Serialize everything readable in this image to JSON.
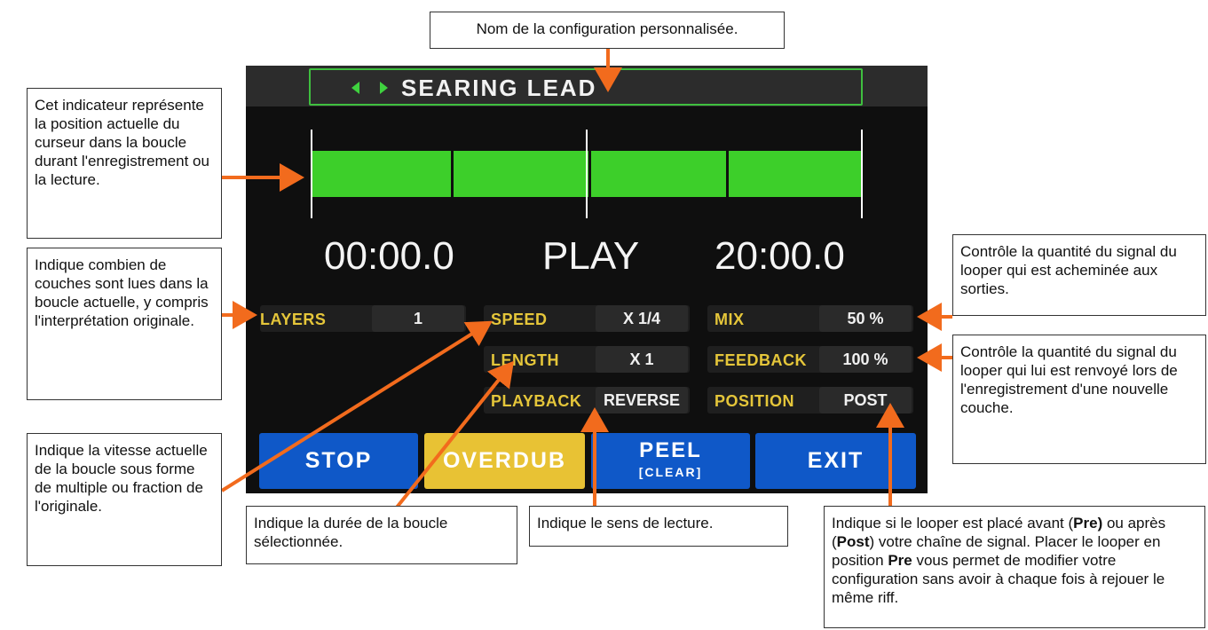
{
  "screen": {
    "preset_name": "SEARING LEAD",
    "loop": {
      "cursor_fraction": 0.0,
      "segments": 4
    },
    "time_left": "00:00.0",
    "state": "PLAY",
    "time_right": "20:00.0",
    "params": {
      "layers": {
        "label": "LAYERS",
        "value": "1"
      },
      "speed": {
        "label": "SPEED",
        "value": "X 1/4"
      },
      "length": {
        "label": "LENGTH",
        "value": "X 1"
      },
      "playback": {
        "label": "PLAYBACK",
        "value": "REVERSE"
      },
      "mix": {
        "label": "MIX",
        "value": "50 %"
      },
      "feedback": {
        "label": "FEEDBACK",
        "value": "100 %"
      },
      "position": {
        "label": "POSITION",
        "value": "POST"
      }
    },
    "buttons": {
      "stop": "STOP",
      "overdub": "OVERDUB",
      "peel": "PEEL",
      "peel_sub": "[CLEAR]",
      "exit": "EXIT"
    }
  },
  "callouts": {
    "preset_name": "Nom de la configuration personnalisée.",
    "cursor": "Cet indicateur représente la position actuelle du curseur dans la boucle durant l'enregistrement ou la lecture.",
    "layers": "Indique combien de couches sont lues dans la boucle actuelle, y compris l'interprétation originale.",
    "speed": "Indique la vitesse actuelle de la boucle sous forme de multiple ou fraction de l'originale.",
    "length": "Indique la durée de la boucle sélectionnée.",
    "playback": "Indique le sens de lecture.",
    "mix": "Contrôle la quantité du signal du looper qui est acheminée aux sorties.",
    "feedback": "Contrôle la quantité du signal du looper qui lui est renvoyé lors de l'enregistrement d'une nouvelle couche.",
    "position": {
      "t1": "Indique si le looper est placé avant (",
      "b1": "Pre)",
      "t2": " ou après (",
      "b2": "Post",
      "t3": ") votre chaîne de signal. Placer le looper en position ",
      "b3": "Pre",
      "t4": " vous permet de modifier votre configuration sans avoir à chaque fois à rejouer le même riff."
    }
  },
  "colors": {
    "accent_green": "#3dcf2a",
    "label_yellow": "#e5c63a",
    "button_blue": "#0f58c8",
    "button_yellow": "#e8c234",
    "arrow_orange": "#f26b1d"
  }
}
